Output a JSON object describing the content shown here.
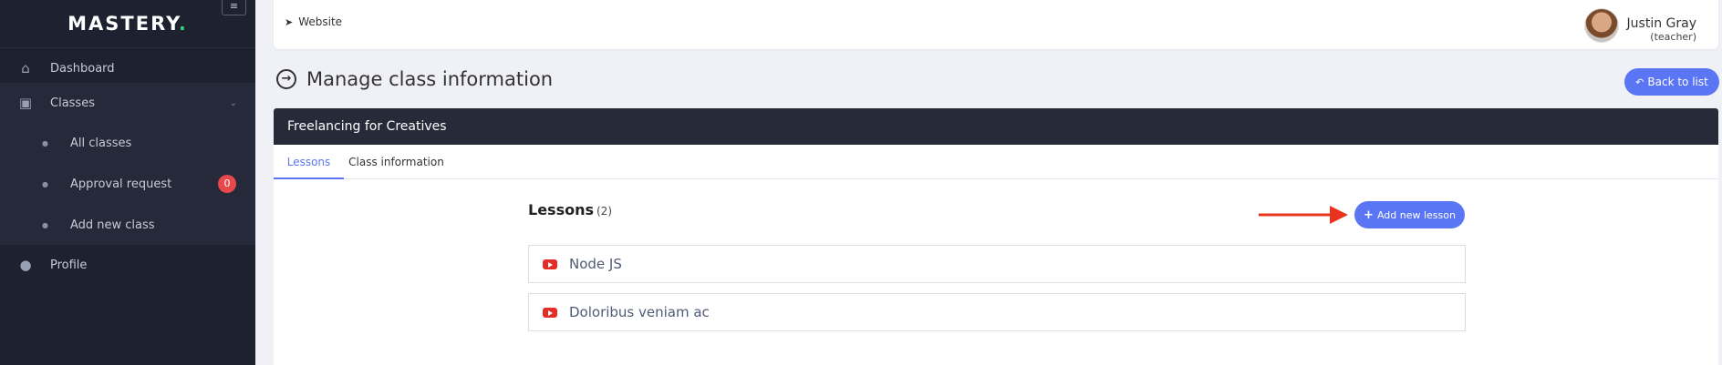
{
  "sidebar": {
    "brand": "MASTERY",
    "brand_dot": ".",
    "toggle_icon": "≡",
    "items": [
      {
        "label": "Dashboard",
        "icon": "home-icon"
      },
      {
        "label": "Classes",
        "icon": "chalkboard-icon"
      },
      {
        "label": "Profile",
        "icon": "user-icon"
      }
    ],
    "submenu": [
      {
        "label": "All classes"
      },
      {
        "label": "Approval request",
        "badge": "0"
      },
      {
        "label": "Add new class"
      }
    ]
  },
  "topbar": {
    "website_label": "Website",
    "user_name": "Justin Gray",
    "user_role": "(teacher)"
  },
  "page": {
    "title": "Manage class information",
    "back_label": "Back to list"
  },
  "card": {
    "header": "Freelancing for Creatives",
    "tabs": [
      {
        "label": "Lessons",
        "active": true
      },
      {
        "label": "Class information",
        "active": false
      }
    ],
    "lessons_title": "Lessons",
    "lessons_count": "(2)",
    "add_label": "Add new lesson",
    "lessons": [
      {
        "title": "Node JS"
      },
      {
        "title": "Doloribus veniam ac"
      }
    ]
  },
  "colors": {
    "accent": "#5a76f5",
    "sidebar_bg": "#1e2130",
    "badge": "#e8474b",
    "arrow": "#e8341c",
    "youtube": "#e52d27"
  }
}
